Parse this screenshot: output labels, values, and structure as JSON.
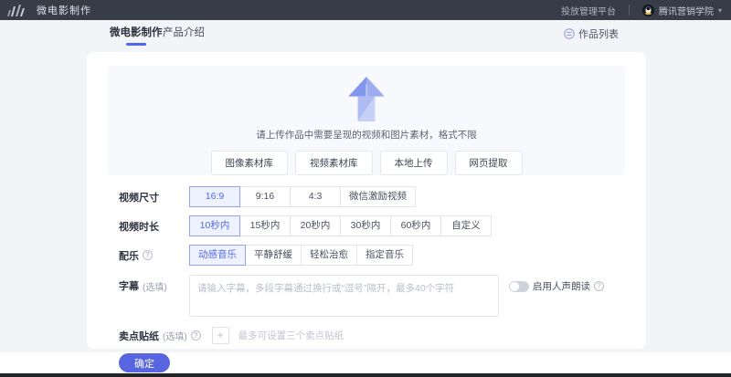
{
  "topbar": {
    "title": "微电影制作",
    "platform": "投放管理平台",
    "account": "腾讯营销学院"
  },
  "tabs": {
    "tab1": "微电影制作",
    "tab2": "产品介绍",
    "works_list": "作品列表"
  },
  "upload": {
    "hint": "请上传作品中需要呈现的视频和图片素材，格式不限",
    "buttons": [
      "图像素材库",
      "视频素材库",
      "本地上传",
      "网页提取"
    ]
  },
  "form": {
    "size": {
      "label": "视频尺寸",
      "options": [
        "16:9",
        "9:16",
        "4:3",
        "微信激励视频"
      ],
      "selected": "16:9"
    },
    "duration": {
      "label": "视频时长",
      "options": [
        "10秒内",
        "15秒内",
        "20秒内",
        "30秒内",
        "60秒内",
        "自定义"
      ],
      "selected": "10秒内"
    },
    "music": {
      "label": "配乐",
      "options": [
        "动感音乐",
        "平静舒缓",
        "轻松治愈",
        "指定音乐"
      ],
      "selected": "动感音乐"
    },
    "subtitle": {
      "label": "字幕",
      "optional": "(选填)",
      "placeholder": "请输入字幕，多段字幕通过换行或“逗号”隔开，最多40个字符",
      "voice_toggle": "启用人声朗读",
      "voice_toggle_state": "off"
    },
    "sticker": {
      "label": "卖点贴纸",
      "optional": "(选填)",
      "hint": "最多可设置三个卖点贴纸"
    }
  },
  "actions": {
    "confirm": "确定"
  },
  "icons": {
    "help": "?",
    "plus": "+",
    "caret": "▾"
  },
  "colors": {
    "accent": "#5468e8",
    "topbar_bg": "#373c49",
    "selected_bg": "#eef2fe",
    "page_bg": "#f2f4f8",
    "confirm_bg": "#5766e0"
  }
}
